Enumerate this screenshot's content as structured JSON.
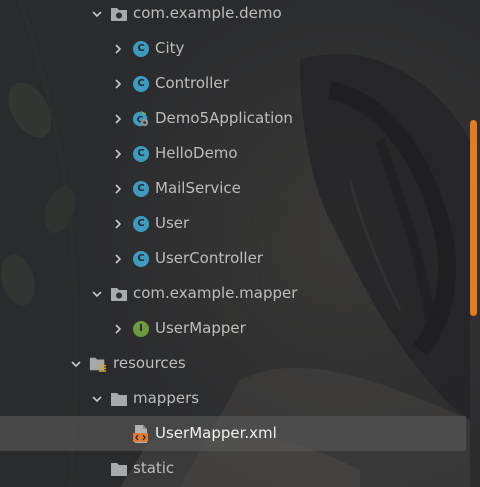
{
  "colors": {
    "class_icon": "#3d9bbf",
    "interface_icon": "#6d9a3a",
    "folder_icon": "#a7a9ab",
    "selection_bg": "#585858",
    "scrollbar": "#e67a1f",
    "xml_icon": "#e07b39"
  },
  "tree": [
    {
      "label": "com.example.demo",
      "icon": "package-folder-icon",
      "chevron": "chevron-down-icon"
    },
    {
      "label": "City",
      "icon": "class-icon",
      "chevron": "chevron-right-icon"
    },
    {
      "label": "Controller",
      "icon": "class-icon",
      "chevron": "chevron-right-icon"
    },
    {
      "label": "Demo5Application",
      "icon": "spring-boot-class-icon",
      "chevron": "chevron-right-icon"
    },
    {
      "label": "HelloDemo",
      "icon": "class-icon",
      "chevron": "chevron-right-icon"
    },
    {
      "label": "MailService",
      "icon": "class-icon",
      "chevron": "chevron-right-icon"
    },
    {
      "label": "User",
      "icon": "class-icon",
      "chevron": "chevron-right-icon"
    },
    {
      "label": "UserController",
      "icon": "class-icon",
      "chevron": "chevron-right-icon"
    },
    {
      "label": "com.example.mapper",
      "icon": "package-folder-icon",
      "chevron": "chevron-down-icon"
    },
    {
      "label": "UserMapper",
      "icon": "interface-icon",
      "chevron": "chevron-right-icon"
    },
    {
      "label": "resources",
      "icon": "resources-folder-icon",
      "chevron": "chevron-down-icon"
    },
    {
      "label": "mappers",
      "icon": "folder-icon",
      "chevron": "chevron-down-icon"
    },
    {
      "label": "UserMapper.xml",
      "icon": "xml-file-icon",
      "chevron": "",
      "selected": true
    },
    {
      "label": "static",
      "icon": "folder-icon",
      "chevron": ""
    }
  ]
}
